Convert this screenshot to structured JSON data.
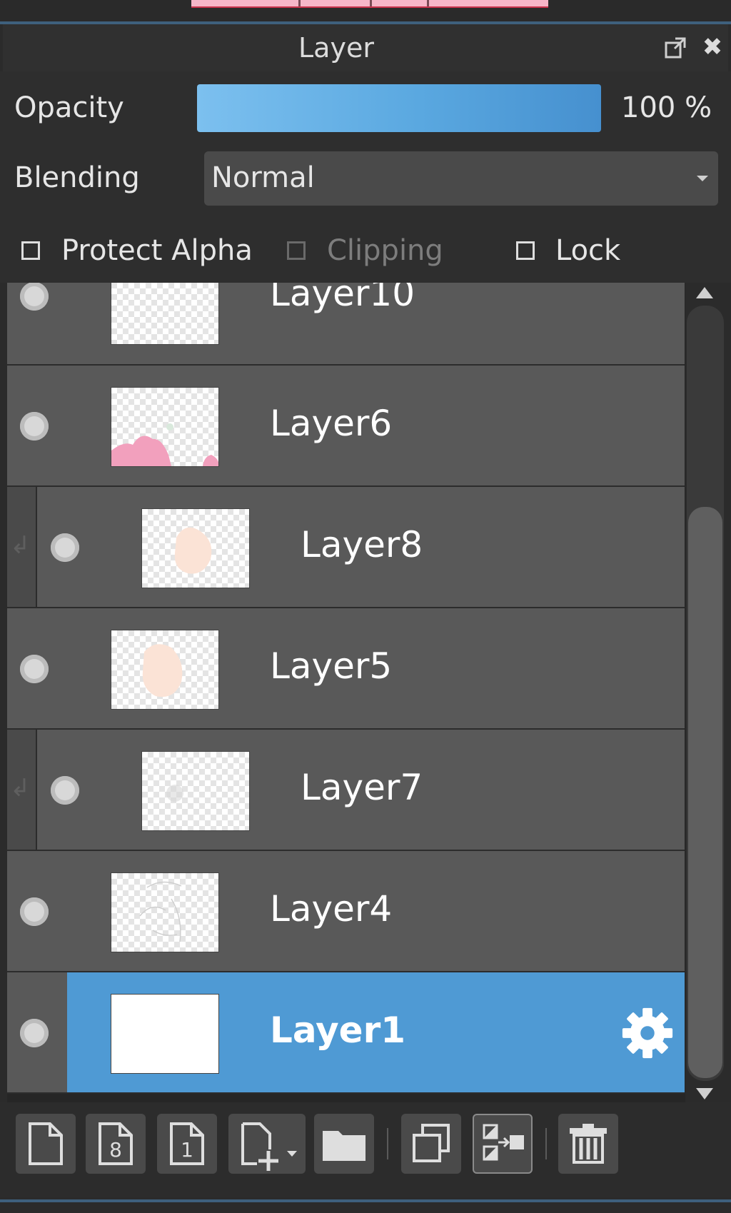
{
  "panel": {
    "title": "Layer"
  },
  "options": {
    "opacity_label": "Opacity",
    "opacity_value": "100 %",
    "opacity_fraction": 1.0,
    "blending_label": "Blending",
    "blending_value": "Normal",
    "protect_alpha_label": "Protect Alpha",
    "clipping_label": "Clipping",
    "lock_label": "Lock"
  },
  "layers": [
    {
      "name": "Layer10",
      "clipped": false,
      "selected": false
    },
    {
      "name": "Layer6",
      "clipped": false,
      "selected": false
    },
    {
      "name": "Layer8",
      "clipped": true,
      "selected": false
    },
    {
      "name": "Layer5",
      "clipped": false,
      "selected": false
    },
    {
      "name": "Layer7",
      "clipped": true,
      "selected": false
    },
    {
      "name": "Layer4",
      "clipped": false,
      "selected": false
    },
    {
      "name": "Layer1",
      "clipped": false,
      "selected": true
    }
  ],
  "toolbar": {
    "buttons": [
      "new-layer-icon",
      "new-8bit-layer-icon",
      "new-1bit-layer-icon",
      "add-layer-menu-icon",
      "folder-icon",
      "duplicate-icon",
      "merge-down-icon",
      "trash-icon"
    ],
    "bit8_text": "8",
    "bit1_text": "1"
  },
  "colors": {
    "accent": "#4f9ad4",
    "row": "#595959",
    "panel": "#2e2e2e"
  }
}
